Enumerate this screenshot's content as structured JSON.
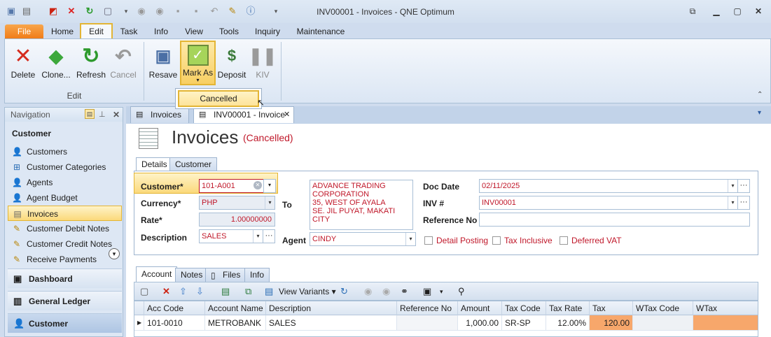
{
  "window": {
    "title": "INV00001 - Invoices - QNE Optimum"
  },
  "ribbon_tabs": [
    "File",
    "Home",
    "Edit",
    "Task",
    "Info",
    "View",
    "Tools",
    "Inquiry",
    "Maintenance"
  ],
  "ribbon": {
    "buttons": [
      "Delete",
      "Clone...",
      "Refresh",
      "Cancel",
      "Resave",
      "Mark As",
      "Deposit",
      "KIV"
    ],
    "group_edit": "Edit",
    "dropdown_item": "Cancelled"
  },
  "nav": {
    "header": "Navigation",
    "section": "Customer",
    "items": [
      "Customers",
      "Customer Categories",
      "Agents",
      "Agent Budget",
      "Invoices",
      "Customer Debit Notes",
      "Customer Credit Notes",
      "Receive Payments"
    ],
    "big_items": [
      "Dashboard",
      "General Ledger",
      "Customer"
    ]
  },
  "doc_tabs": [
    "Invoices",
    "INV00001 - Invoice"
  ],
  "page": {
    "title": "Invoices",
    "status": "(Cancelled)"
  },
  "sub_tabs": [
    "Details",
    "Customer"
  ],
  "form": {
    "customer_label": "Customer*",
    "customer_value": "101-A001",
    "currency_label": "Currency*",
    "currency_value": "PHP",
    "rate_label": "Rate*",
    "rate_value": "1.00000000",
    "description_label": "Description",
    "description_value": "SALES",
    "to_label": "To",
    "address": "ADVANCE TRADING\nCORPORATION\n35, WEST OF AYALA\nSE. JIL PUYAT, MAKATI\nCITY",
    "agent_label": "Agent",
    "agent_value": "CINDY",
    "docdate_label": "Doc Date",
    "docdate_value": "02/11/2025",
    "inv_label": "INV #",
    "inv_value": "INV00001",
    "refno_label": "Reference No",
    "refno_value": "",
    "chk_detail": "Detail Posting",
    "chk_taxinc": "Tax Inclusive",
    "chk_deferred": "Deferred VAT"
  },
  "bottom_tabs": [
    "Account",
    "Notes",
    "Files",
    "Info"
  ],
  "toolbar": {
    "view_variants": "View Variants"
  },
  "grid": {
    "columns": [
      "Acc Code",
      "Account Name",
      "Description",
      "Reference No",
      "Amount",
      "Tax Code",
      "Tax Rate",
      "Tax",
      "WTax Code",
      "WTax"
    ],
    "row": [
      "101-0010",
      "METROBANK",
      "SALES",
      "",
      "1,000.00",
      "SR-SP",
      "12.00%",
      "120.00",
      "",
      ""
    ]
  }
}
